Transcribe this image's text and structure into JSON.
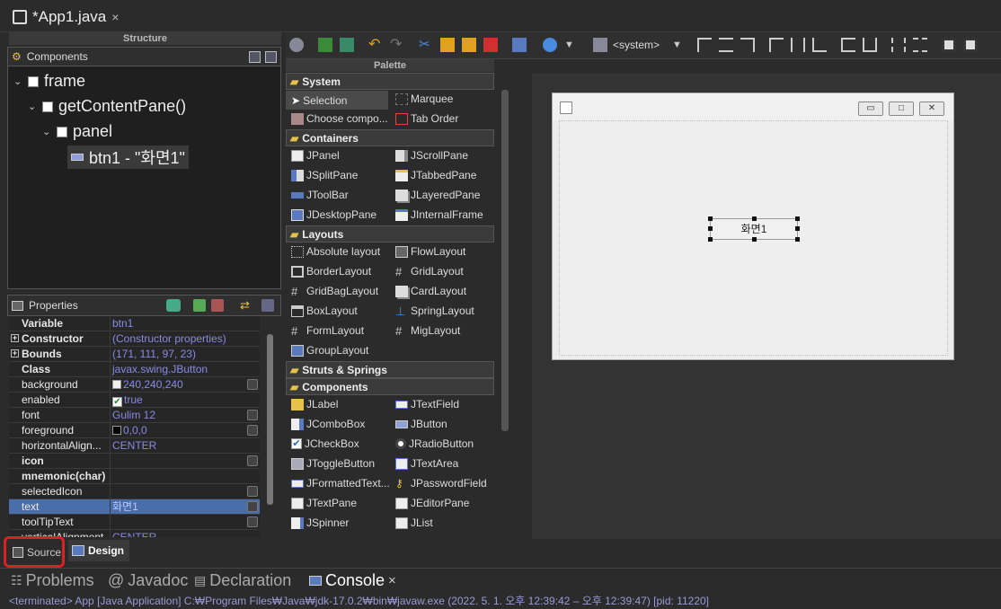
{
  "editor_tab": {
    "title": "*App1.java",
    "close": "×"
  },
  "structure": {
    "title": "Structure",
    "components_label": "Components",
    "tree": [
      {
        "label": "frame"
      },
      {
        "label": "getContentPane()"
      },
      {
        "label": "panel"
      },
      {
        "label": "btn1 - \"화면1\""
      }
    ]
  },
  "properties": {
    "label": "Properties",
    "rows": [
      {
        "name": "Variable",
        "value": "btn1"
      },
      {
        "name": "Constructor",
        "value": "(Constructor properties)"
      },
      {
        "name": "Bounds",
        "value": "(171, 111, 97, 23)"
      },
      {
        "name": "Class",
        "value": "javax.swing.JButton"
      },
      {
        "name": "background",
        "value": "240,240,240"
      },
      {
        "name": "enabled",
        "value": "true"
      },
      {
        "name": "font",
        "value": "Gulim 12"
      },
      {
        "name": "foreground",
        "value": "0,0,0"
      },
      {
        "name": "horizontalAlign...",
        "value": "CENTER"
      },
      {
        "name": "icon",
        "value": ""
      },
      {
        "name": "mnemonic(char)",
        "value": ""
      },
      {
        "name": "selectedIcon",
        "value": ""
      },
      {
        "name": "text",
        "value": "화면1"
      },
      {
        "name": "toolTipText",
        "value": ""
      },
      {
        "name": "verticalAlignment",
        "value": "CENTER"
      }
    ]
  },
  "design_tabs": {
    "source": "Source",
    "design": "Design"
  },
  "toolbar": {
    "system_combo": "<system>"
  },
  "palette": {
    "title": "Palette",
    "categories": {
      "system": "System",
      "containers": "Containers",
      "layouts": "Layouts",
      "struts": "Struts & Springs",
      "components": "Components"
    },
    "system": [
      "Selection",
      "Marquee",
      "Choose compo...",
      "Tab Order"
    ],
    "containers": [
      "JPanel",
      "JScrollPane",
      "JSplitPane",
      "JTabbedPane",
      "JToolBar",
      "JLayeredPane",
      "JDesktopPane",
      "JInternalFrame"
    ],
    "layouts": [
      "Absolute layout",
      "FlowLayout",
      "BorderLayout",
      "GridLayout",
      "GridBagLayout",
      "CardLayout",
      "BoxLayout",
      "SpringLayout",
      "FormLayout",
      "MigLayout",
      "GroupLayout"
    ],
    "components": [
      "JLabel",
      "JTextField",
      "JComboBox",
      "JButton",
      "JCheckBox",
      "JRadioButton",
      "JToggleButton",
      "JTextArea",
      "JFormattedText...",
      "JPasswordField",
      "JTextPane",
      "JEditorPane",
      "JSpinner",
      "JList"
    ]
  },
  "design": {
    "button_text": "화면1",
    "win_min": "▭",
    "win_max": "□",
    "win_close": "✕"
  },
  "bottom_tabs": {
    "problems": "Problems",
    "javadoc": "Javadoc",
    "declaration": "Declaration",
    "console": "Console",
    "close": "×"
  },
  "console": {
    "status": "<terminated> App [Java Application] C:₩Program Files₩Java₩jdk-17.0.2₩bin₩javaw.exe  (2022. 5. 1. 오후 12:39:42 – 오후 12:39:47) [pid: 11220]"
  },
  "colors": {
    "accent": "#4a6ea9",
    "highlight": "#e02020"
  }
}
